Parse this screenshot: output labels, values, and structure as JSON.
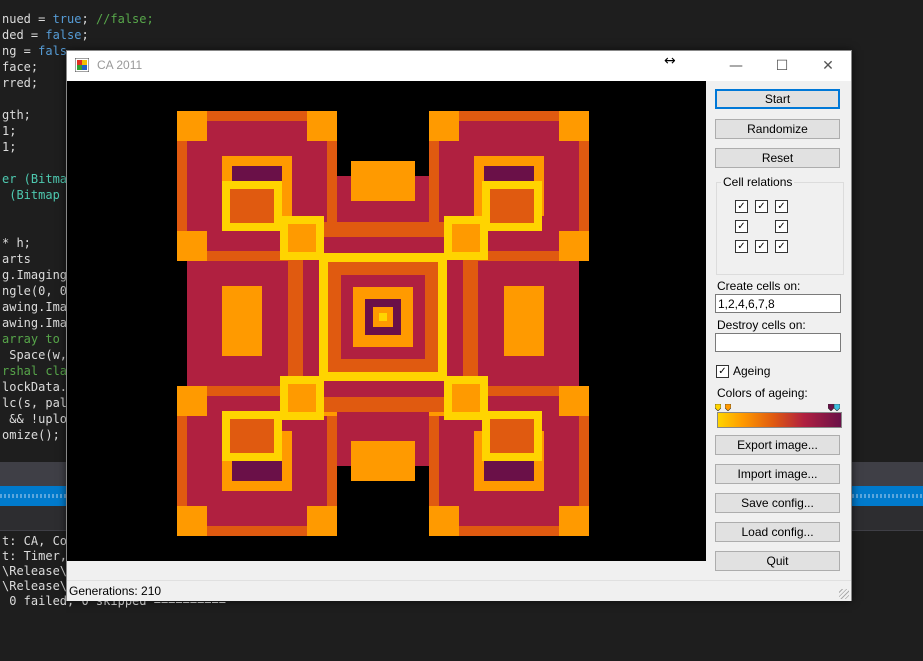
{
  "ide": {
    "code_lines": [
      [
        "nued = ",
        "true",
        "; ",
        "//false;"
      ],
      [
        "ded = ",
        "false",
        ";",
        ""
      ],
      [
        "ng = ",
        "fals",
        "",
        ""
      ],
      [
        "face;",
        "",
        "",
        ""
      ],
      [
        "rred;",
        "",
        "",
        ""
      ],
      [
        "",
        "",
        "",
        ""
      ],
      [
        "gth;",
        "",
        "",
        ""
      ],
      [
        "1;",
        "",
        "",
        ""
      ],
      [
        "1;",
        "",
        "",
        ""
      ],
      [
        "",
        "",
        "",
        ""
      ],
      [
        "er (Bitmap",
        "",
        "",
        ""
      ],
      [
        " (Bitmap",
        "",
        "",
        ""
      ]
    ],
    "code_lines2": [
      "* h;",
      "arts",
      "g.Imaging",
      "ngle(0, 0",
      "awing.Imag",
      "awing.Imag",
      "array to",
      " Space(w,",
      "rshal cla",
      "lockData.",
      "lc(s, pal",
      " && !uplo",
      "omize();"
    ],
    "output_lines": [
      "t: CA, Con",
      "t: Timer,",
      "\\Release\\",
      "\\Release\\C",
      " 0 failed, 0 skipped =========="
    ]
  },
  "window": {
    "title": "CA 2011",
    "minimize": "—",
    "maximize": "☐",
    "close": "✕",
    "resize_icon": "↔"
  },
  "buttons": {
    "start": "Start",
    "randomize": "Randomize",
    "reset": "Reset",
    "export": "Export image...",
    "import": "Import image...",
    "save": "Save config...",
    "load": "Load config...",
    "quit": "Quit"
  },
  "cell_relations": {
    "title": "Cell relations",
    "grid": [
      [
        true,
        true,
        true
      ],
      [
        true,
        null,
        true
      ],
      [
        true,
        true,
        true
      ]
    ]
  },
  "create_label": "Create cells on:",
  "create_value": "1,2,4,6,7,8",
  "destroy_label": "Destroy cells on:",
  "destroy_value": "",
  "ageing_label": "Ageing",
  "ageing_checked": true,
  "colors_label": "Colors of ageing:",
  "status_text": "Generations: 210",
  "colors": {
    "canvas_bg": "#000000",
    "age1": "#ffd400",
    "age2": "#ff9a00",
    "age3": "#e05a10",
    "age4": "#b02040",
    "age5": "#6a1048",
    "accent": "#0078d7"
  }
}
